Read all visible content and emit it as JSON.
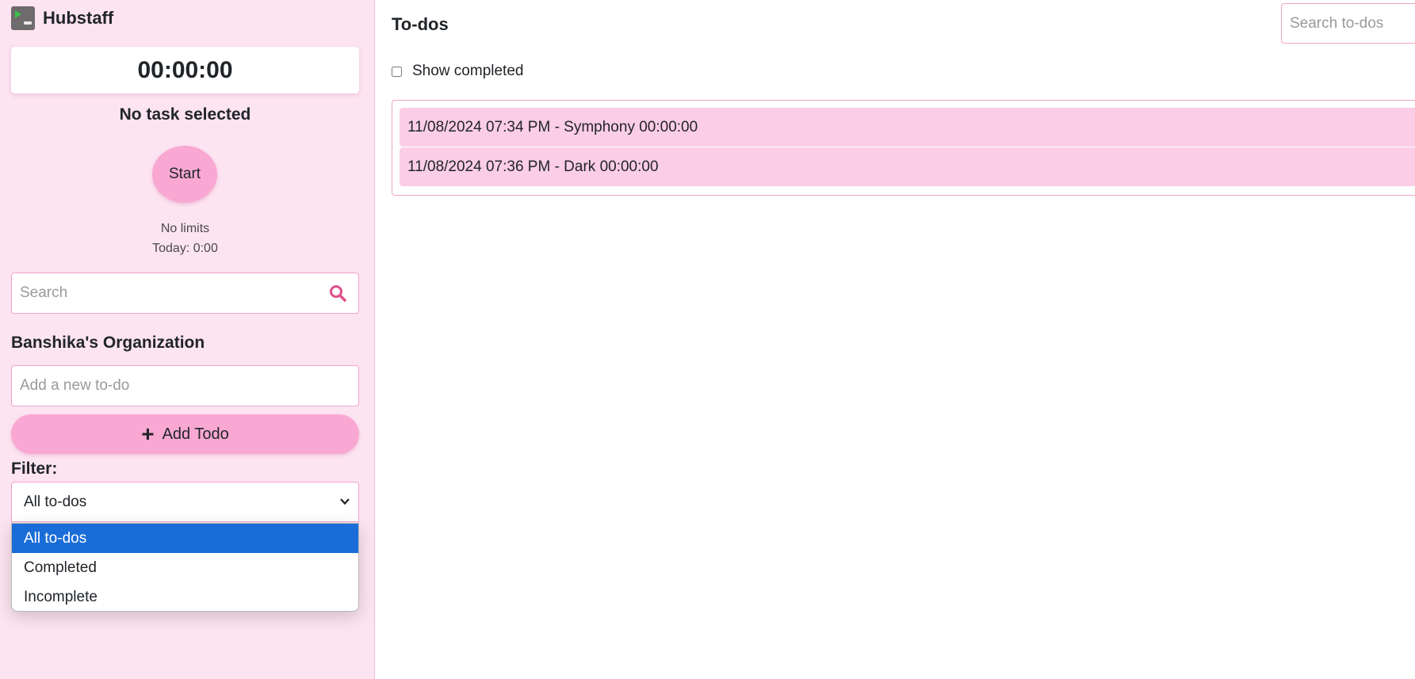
{
  "brand": {
    "name": "Hubstaff",
    "logo_icon": "hubstaff-logo-icon"
  },
  "timer": {
    "value": "00:00:00",
    "task_status": "No task selected",
    "start_label": "Start",
    "limits": "No limits",
    "today": "Today: 0:00"
  },
  "sidebar_search": {
    "placeholder": "Search",
    "icon": "search-icon"
  },
  "organization": {
    "name": "Banshika's Organization"
  },
  "new_todo": {
    "placeholder": "Add a new to-do",
    "add_label": "Add Todo",
    "add_icon": "plus-icon"
  },
  "filter": {
    "label": "Filter:",
    "selected": "All to-dos",
    "options": [
      "All to-dos",
      "Completed",
      "Incomplete"
    ]
  },
  "main": {
    "title": "To-dos",
    "search_placeholder": "Search to-dos",
    "show_completed_label": "Show completed",
    "todos": [
      {
        "text": "11/08/2024 07:34 PM - Symphony 00:00:00"
      },
      {
        "text": "11/08/2024 07:36 PM - Dark 00:00:00"
      }
    ]
  },
  "colors": {
    "sidebar_bg": "#fde4f1",
    "accent_pink": "#f8a8d3",
    "todo_bg": "#fbcde6",
    "selected_option": "#1a6dd8",
    "search_icon": "#e0508e"
  }
}
